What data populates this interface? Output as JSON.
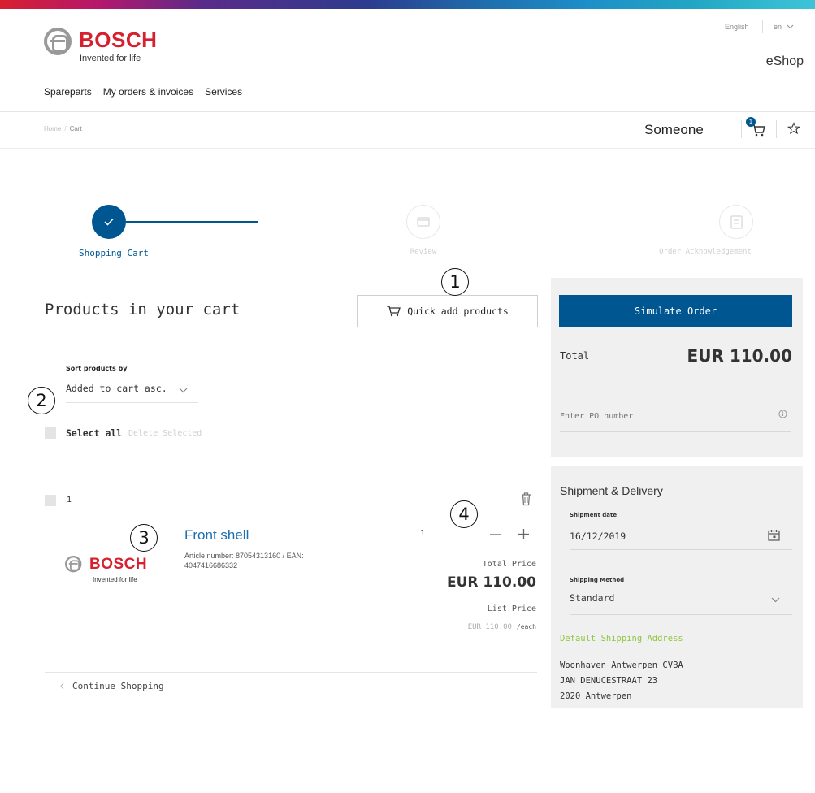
{
  "header": {
    "brand_name": "BOSCH",
    "brand_tagline": "Invented for life",
    "language": "English",
    "country": "en",
    "shop_name": "eShop",
    "nav": [
      "Spareparts",
      "My orders & invoices",
      "Services"
    ]
  },
  "subheader": {
    "breadcrumb_home": "Home",
    "breadcrumb_separator": "/",
    "breadcrumb_current": "Cart",
    "user_name": "Someone",
    "cart_count": "1"
  },
  "steps": [
    {
      "label": "Shopping Cart",
      "state": "completed"
    },
    {
      "label": "Review",
      "state": "pending"
    },
    {
      "label": "Order Acknowledgement",
      "state": "pending"
    }
  ],
  "cart": {
    "title": "Products in your cart",
    "quick_add_label": "Quick add products",
    "sort_label": "Sort products by",
    "sort_value": "Added to cart asc.",
    "select_all_label": "Select all",
    "delete_selected_label": "Delete Selected",
    "continue_shopping_label": "Continue Shopping"
  },
  "item": {
    "index": "1",
    "name": "Front shell",
    "article_info": "Article number: 87054313160 / EAN: 4047416686332",
    "brand_name": "BOSCH",
    "brand_tagline": "Invented for life",
    "quantity": "1",
    "total_price_label": "Total Price",
    "total_price": "EUR 110.00",
    "list_price_label": "List Price",
    "list_price": "EUR 110.00",
    "list_price_unit": "/each"
  },
  "summary": {
    "simulate_button": "Simulate Order",
    "total_label": "Total",
    "total_value": "EUR 110.00",
    "po_placeholder": "Enter PO number"
  },
  "shipment": {
    "title": "Shipment & Delivery",
    "date_label": "Shipment date",
    "date_value": "16/12/2019",
    "method_label": "Shipping Method",
    "method_value": "Standard",
    "address_title": "Default Shipping Address",
    "address_lines": [
      "Woonhaven Antwerpen CVBA",
      "JAN DENUCESTRAAT 23",
      "2020 Antwerpen"
    ]
  },
  "callouts": [
    "1",
    "2",
    "3",
    "4"
  ],
  "colors": {
    "brand_red": "#d7202f",
    "primary_blue": "#005691",
    "link_blue": "#1a6fb0",
    "address_green": "#8ec641",
    "panel_gray": "#f0f0f0"
  },
  "icons": [
    "bosch-logo-icon",
    "cart-icon",
    "star-icon",
    "check-icon",
    "review-icon",
    "acknowledgement-icon",
    "quick-add-cart-icon",
    "chevron-down-icon",
    "info-icon",
    "trash-icon",
    "minus-icon",
    "plus-icon",
    "calendar-icon",
    "chevron-left-icon"
  ]
}
